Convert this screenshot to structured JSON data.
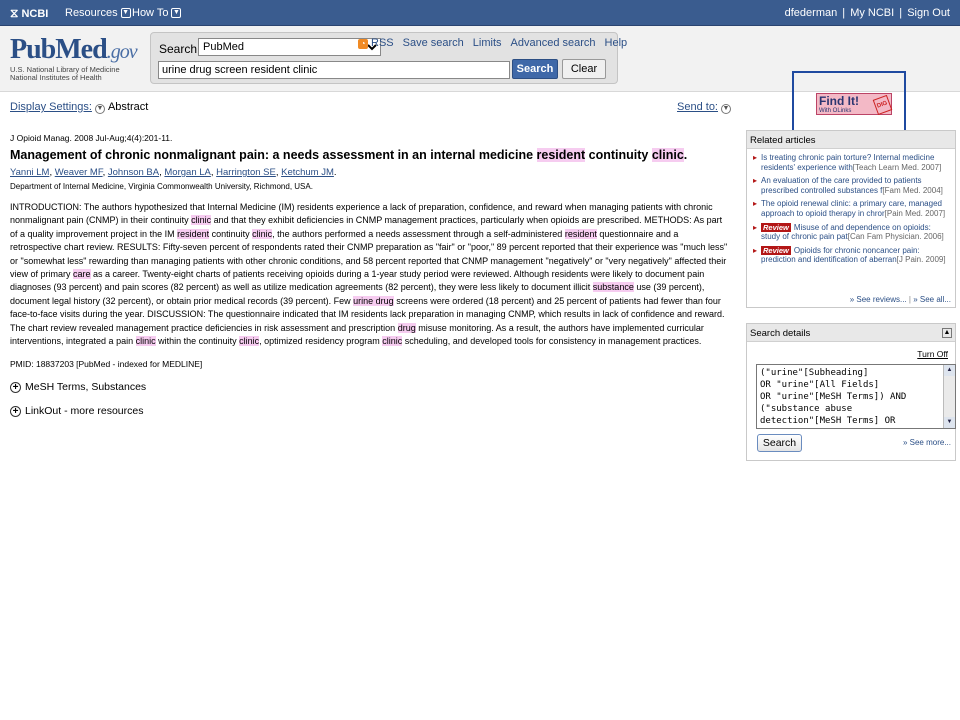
{
  "topbar": {
    "ncbi": "NCBI",
    "resources": "Resources",
    "howto": "How To",
    "user": "dfederman",
    "my_ncbi": "My NCBI",
    "sign_out": "Sign Out"
  },
  "header": {
    "brand_pub": "PubMed",
    "brand_gov": ".gov",
    "sub1": "U.S. National Library of Medicine",
    "sub2": "National Institutes of Health",
    "search_label": "Search:",
    "database": "PubMed",
    "query": "urine drug screen resident clinic",
    "search_btn": "Search",
    "clear_btn": "Clear",
    "links": {
      "rss": "RSS",
      "save": "Save search",
      "limits": "Limits",
      "advanced": "Advanced search",
      "help": "Help"
    }
  },
  "display": {
    "settings": "Display Settings:",
    "format": "Abstract",
    "send_to": "Send to:"
  },
  "article": {
    "citation": "J Opioid Manag. 2008 Jul-Aug;4(4):201-11.",
    "title_a": "Management of chronic nonmalignant pain: a needs assessment in an internal medicine ",
    "title_hl1": "resident",
    "title_b": " continuity ",
    "title_hl2": "clinic",
    "title_c": ".",
    "authors": [
      "Yanni LM",
      "Weaver MF",
      "Johnson BA",
      "Morgan LA",
      "Harrington SE",
      "Ketchum JM"
    ],
    "affiliation": "Department of Internal Medicine, Virginia Commonwealth University, Richmond, USA.",
    "abstract_parts": [
      {
        "t": "INTRODUCTION: The authors hypothesized that Internal Medicine (IM) residents experience a lack of preparation, confidence, and reward when managing patients with chronic nonmalignant pain (CNMP) in their continuity "
      },
      {
        "t": "clinic",
        "hl": true
      },
      {
        "t": " and that they exhibit deficiencies in CNMP management practices, particularly when opioids are prescribed. METHODS: As part of a quality improvement project in the IM "
      },
      {
        "t": "resident",
        "hl": true
      },
      {
        "t": " continuity "
      },
      {
        "t": "clinic",
        "hl": true
      },
      {
        "t": ", the authors performed a needs assessment through a self-administered "
      },
      {
        "t": "resident",
        "hl": true
      },
      {
        "t": " questionnaire and a retrospective chart review. RESULTS: Fifty-seven percent of respondents rated their CNMP preparation as \"fair\" or \"poor,\" 89 percent reported that their experience was \"much less\" or \"somewhat less\" rewarding than managing patients with other chronic conditions, and 58 percent reported that CNMP management \"negatively\" or \"very negatively\" affected their view of primary "
      },
      {
        "t": "care",
        "hl": true
      },
      {
        "t": " as a career. Twenty-eight charts of patients receiving opioids during a 1-year study period were reviewed. Although residents were likely to document pain diagnoses (93 percent) and pain scores (82 percent) as well as utilize medication agreements (82 percent), they were less likely to document illicit "
      },
      {
        "t": "substance",
        "hl": true
      },
      {
        "t": " use (39 percent), document legal history (32 percent), or obtain prior medical records (39 percent). Few "
      },
      {
        "t": "urine drug",
        "hl": true
      },
      {
        "t": " screens were ordered (18 percent) and 25 percent of patients had fewer than four face-to-face visits during the year. DISCUSSION: The questionnaire indicated that IM residents lack preparation in managing CNMP, which results in lack of confidence and reward. The chart review revealed management practice deficiencies in risk assessment and prescription "
      },
      {
        "t": "drug",
        "hl": true
      },
      {
        "t": " misuse monitoring. As a result, the authors have implemented curricular interventions, integrated a pain "
      },
      {
        "t": "clinic",
        "hl": true
      },
      {
        "t": " within the continuity "
      },
      {
        "t": "clinic",
        "hl": true
      },
      {
        "t": ", optimized residency program "
      },
      {
        "t": "clinic",
        "hl": true
      },
      {
        "t": " scheduling, and developed tools for consistency in management practices."
      }
    ],
    "pmid": "PMID: 18837203 [PubMed - indexed for MEDLINE]",
    "mesh": "MeSH Terms, Substances",
    "linkout": "LinkOut - more resources"
  },
  "findit": {
    "label": "Find It!",
    "small": "With OLinks",
    "stamp": "DIG"
  },
  "related": {
    "title": "Related articles",
    "items": [
      {
        "text": "Is treating chronic pain torture? Internal medicine residents' experience with",
        "src": "[Teach Learn Med. 2007]"
      },
      {
        "text": "An evaluation of the care provided to patients prescribed controlled substances f",
        "src": "[Fam Med. 2004]"
      },
      {
        "text": "The opioid renewal clinic: a primary care, managed approach to opioid therapy in chror",
        "src": "[Pain Med. 2007]"
      },
      {
        "review": "Review",
        "text": "Misuse of and dependence on opioids: study of chronic pain pat",
        "src": "[Can Fam Physician. 2006]"
      },
      {
        "review": "Review",
        "text": "Opioids for chronic noncancer pain: prediction and identification of aberran",
        "src": "[J Pain. 2009]"
      }
    ],
    "see_reviews": "» See reviews...",
    "see_all": "» See all..."
  },
  "search_details": {
    "title": "Search details",
    "turn_off": "Turn Off",
    "query_text": "(\"urine\"[Subheading]\nOR \"urine\"[All Fields]\nOR \"urine\"[MeSH Terms]) AND\n(\"substance abuse\ndetection\"[MeSH Terms] OR",
    "search_btn": "Search",
    "see_more": "» See more..."
  }
}
